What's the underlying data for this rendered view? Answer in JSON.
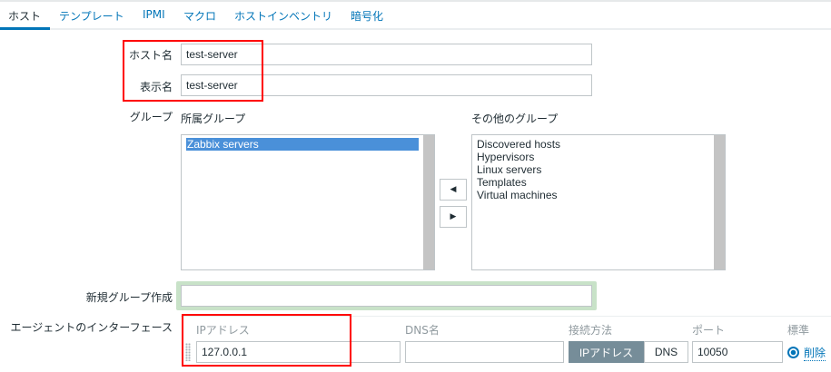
{
  "tabs": [
    {
      "label": "ホスト"
    },
    {
      "label": "テンプレート"
    },
    {
      "label": "IPMI"
    },
    {
      "label": "マクロ"
    },
    {
      "label": "ホストインベントリ"
    },
    {
      "label": "暗号化"
    }
  ],
  "form": {
    "host_name_label": "ホスト名",
    "host_name_value": "test-server",
    "visible_name_label": "表示名",
    "visible_name_value": "test-server",
    "groups_label": "グループ",
    "in_groups_label": "所属グループ",
    "other_groups_label": "その他のグループ",
    "in_groups": [
      "Zabbix servers"
    ],
    "other_groups": [
      "Discovered hosts",
      "Hypervisors",
      "Linux servers",
      "Templates",
      "Virtual machines"
    ],
    "new_group_label": "新規グループ作成",
    "new_group_value": "",
    "interfaces_label": "エージェントのインターフェース",
    "iface_headers": {
      "ip": "IPアドレス",
      "dns": "DNS名",
      "connect": "接続方法",
      "port": "ポート",
      "default": "標準"
    },
    "iface": {
      "ip": "127.0.0.1",
      "dns": "",
      "connect_ip": "IPアドレス",
      "connect_dns": "DNS",
      "port": "10050",
      "remove": "削除"
    }
  },
  "colors": {
    "accent": "#0275b8",
    "highlight": "#ff0000"
  }
}
